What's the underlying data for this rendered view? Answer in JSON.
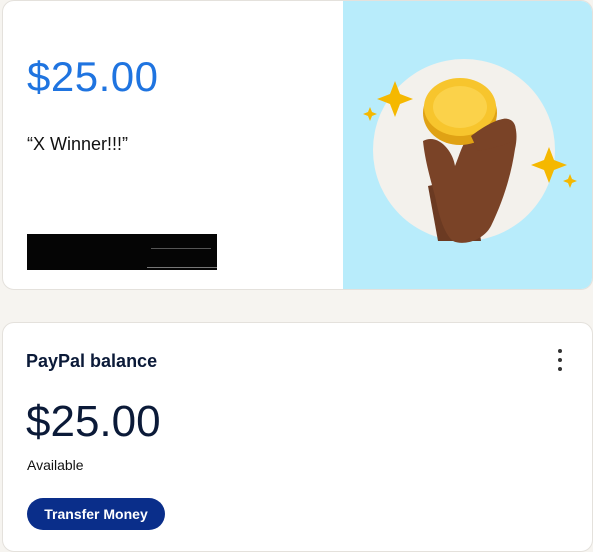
{
  "reward_card": {
    "amount": "$25.00",
    "message": "“X Winner!!!”",
    "colors": {
      "amount": "#1f74e0",
      "illustration_bg": "#b8ecfb"
    },
    "illustration": "hand-holding-coin-icon"
  },
  "balance_card": {
    "title": "PayPal balance",
    "amount": "$25.00",
    "status": "Available",
    "transfer_label": "Transfer Money",
    "menu_icon": "more-vertical-icon",
    "colors": {
      "button": "#0a2e8a"
    }
  }
}
